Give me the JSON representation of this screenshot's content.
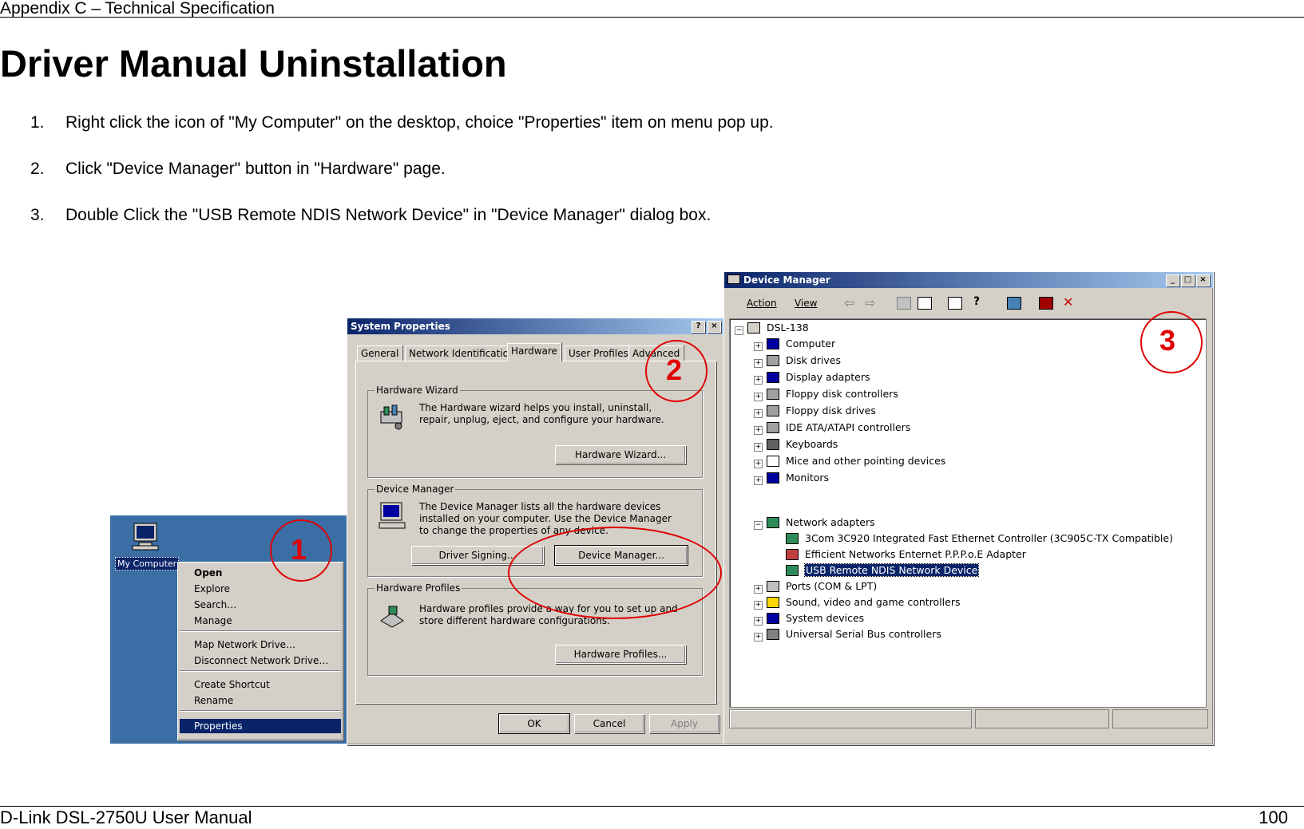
{
  "header": "Appendix C – Technical Specification",
  "title": "Driver Manual Uninstallation",
  "steps": [
    {
      "num": "1.",
      "text": "Right click the icon of \"My Computer\" on the desktop, choice \"Properties\" item on menu pop up."
    },
    {
      "num": "2.",
      "text": "Click \"Device Manager\" button in \"Hardware\" page."
    },
    {
      "num": "3.",
      "text": "Double Click the \"USB Remote NDIS Network Device\" in \"Device Manager\" dialog box."
    }
  ],
  "desktop": {
    "background": "#3a6ea5",
    "icon_label": "My Computer",
    "menu": [
      "Open",
      "Explore",
      "Search…",
      "Manage",
      "Map Network Drive…",
      "Disconnect Network Drive…",
      "Create Shortcut",
      "Rename",
      "Properties"
    ]
  },
  "system_properties": {
    "title": "System Properties",
    "tabs": [
      "General",
      "Network Identification",
      "Hardware",
      "User Profiles",
      "Advanced"
    ],
    "active_tab": "Hardware",
    "hardware_wizard": {
      "label": "Hardware Wizard",
      "desc": "The Hardware wizard helps you install, uninstall, repair, unplug, eject, and configure your hardware.",
      "button": "Hardware Wizard..."
    },
    "device_manager": {
      "label": "Device Manager",
      "desc": "The Device Manager lists all the hardware devices installed on your computer. Use the Device Manager to change the properties of any device.",
      "button1": "Driver Signing...",
      "button2": "Device Manager..."
    },
    "hardware_profiles": {
      "label": "Hardware Profiles",
      "desc": "Hardware profiles provide a way for you to set up and store different hardware configurations.",
      "button": "Hardware Profiles..."
    },
    "buttons": {
      "ok": "OK",
      "cancel": "Cancel",
      "apply": "Apply"
    }
  },
  "device_manager": {
    "title": "Device Manager",
    "menus": [
      "Action",
      "View"
    ],
    "root": "DSL-138",
    "items": [
      "Computer",
      "Disk drives",
      "Display adapters",
      "Floppy disk controllers",
      "Floppy disk drives",
      "IDE ATA/ATAPI controllers",
      "Keyboards",
      "Mice and other pointing devices",
      "Monitors",
      "Network adapters"
    ],
    "network_children": [
      "3Com 3C920 Integrated Fast Ethernet Controller (3C905C-TX Compatible)",
      "Efficient Networks Enternet P.P.P.o.E Adapter",
      "USB Remote NDIS Network Device"
    ],
    "items_after": [
      "Ports (COM & LPT)",
      "Sound, video and game controllers",
      "System devices",
      "Universal Serial Bus controllers"
    ]
  },
  "callouts": [
    "1",
    "2",
    "3"
  ],
  "footer": {
    "left": "D-Link DSL-2750U User Manual",
    "right": "100"
  },
  "colors": {
    "callout": "#e00000",
    "titlebar": "#0a246a",
    "selection": "#0a246a"
  }
}
